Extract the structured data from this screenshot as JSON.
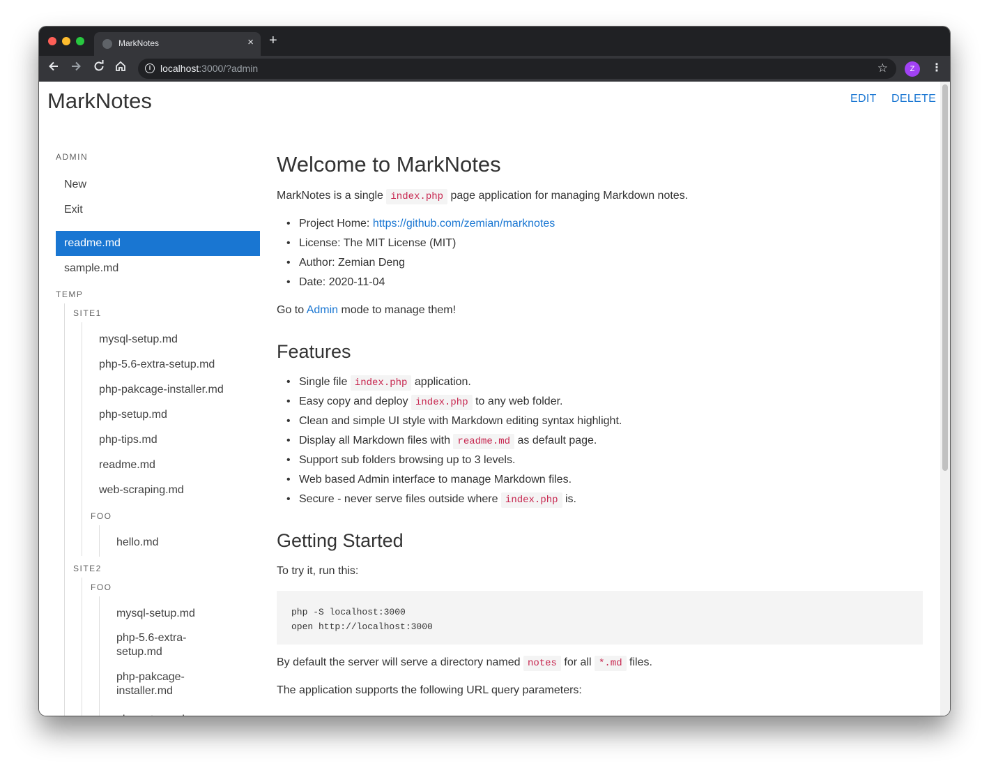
{
  "browser": {
    "tab_title": "MarkNotes",
    "url_host": "localhost",
    "url_rest": ":3000/?admin",
    "profile_initial": "Z",
    "profile_color": "#a142f4",
    "tab_close": "×",
    "new_tab": "+",
    "icons": [
      "back-icon",
      "forward-icon",
      "reload-icon",
      "home-icon",
      "info-icon",
      "star-icon",
      "menu-icon"
    ]
  },
  "header": {
    "brand": "MarkNotes",
    "edit": "EDIT",
    "delete": "DELETE",
    "accent_color": "#1976d2"
  },
  "sidebar": {
    "admin_label": "ADMIN",
    "admin_items": [
      "New",
      "Exit"
    ],
    "root_files": [
      "readme.md",
      "sample.md"
    ],
    "active_file": "readme.md",
    "temp_label": "TEMP",
    "site1_label": "SITE1",
    "site1_files": [
      "mysql-setup.md",
      "php-5.6-extra-setup.md",
      "php-pakcage-installer.md",
      "php-setup.md",
      "php-tips.md",
      "readme.md",
      "web-scraping.md"
    ],
    "site1_foo_label": "FOO",
    "site1_foo_files": [
      "hello.md"
    ],
    "site2_label": "SITE2",
    "site2_foo_label": "FOO",
    "site2_foo_files": [
      "mysql-setup.md",
      "php-5.6-extra-setup.md",
      "php-pakcage-installer.md",
      "php-setup.md"
    ]
  },
  "content": {
    "title": "Welcome to MarkNotes",
    "intro_pre": "MarkNotes is a single",
    "intro_code": "index.php",
    "intro_post": "page application for managing Markdown notes.",
    "info": {
      "home_label": "Project Home:",
      "home_link": "https://github.com/zemian/marknotes",
      "license": "License: The MIT License (MIT)",
      "author": "Author: Zemian Deng",
      "date": "Date: 2020-11-04"
    },
    "goto_pre": "Go to",
    "goto_link": "Admin",
    "goto_post": "mode to manage them!",
    "features_title": "Features",
    "features": {
      "f1_pre": "Single file",
      "f1_code": "index.php",
      "f1_post": "application.",
      "f2_pre": "Easy copy and deploy",
      "f2_code": "index.php",
      "f2_post": "to any web folder.",
      "f3": "Clean and simple UI style with Markdown editing syntax highlight.",
      "f4_pre": "Display all Markdown files with",
      "f4_code": "readme.md",
      "f4_post": "as default page.",
      "f5": "Support sub folders browsing up to 3 levels.",
      "f6": "Web based Admin interface to manage Markdown files.",
      "f7_pre": "Secure - never serve files outside where",
      "f7_code": "index.php",
      "f7_post": "is."
    },
    "started_title": "Getting Started",
    "try_text": "To try it, run this:",
    "code_line1": "php -S localhost:3000",
    "code_line2": "open http://localhost:3000",
    "default_pre": "By default the server will serve a directory named",
    "default_code1": "notes",
    "default_mid": "for all",
    "default_code2": "*.md",
    "default_post": "files.",
    "params_text": "The application supports the following URL query parameters:"
  }
}
